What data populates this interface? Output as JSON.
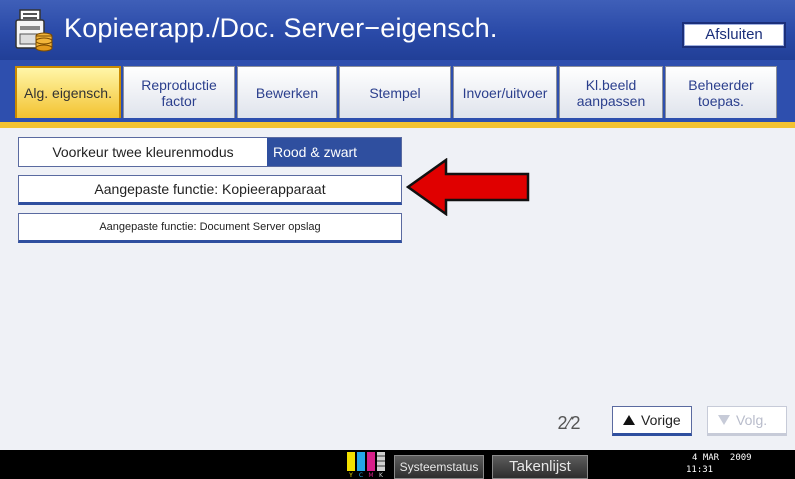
{
  "window": {
    "title": "Kopieerapp./Doc. Server−eigensch.",
    "exit_label": "Afsluiten",
    "icon": "copier-settings-icon"
  },
  "tabs": [
    {
      "label": "Alg. eigensch.",
      "active": true
    },
    {
      "label": "Reproductie\nfactor",
      "active": false
    },
    {
      "label": "Bewerken",
      "active": false
    },
    {
      "label": "Stempel",
      "active": false
    },
    {
      "label": "Invoer/uitvoer",
      "active": false
    },
    {
      "label": "Kl.beeld\naanpassen",
      "active": false
    },
    {
      "label": "Beheerder\ntoepas.",
      "active": false
    }
  ],
  "settings": {
    "two_color_label": "Voorkeur twee kleurenmodus",
    "two_color_value": "Rood & zwart",
    "custom_copier": "Aangepaste functie: Kopieerapparaat",
    "custom_docserver": "Aangepaste functie: Document Server opslag"
  },
  "pagination": {
    "current": 2,
    "total": 2,
    "indicator": "2∕2",
    "prev_label": "Vorige",
    "next_label": "Volg."
  },
  "statusbar": {
    "toner_letters": "YCMK",
    "system_status": "Systeemstatus",
    "jobs": "Takenlijst",
    "date": "4 MAR  2009",
    "time": "11:31"
  },
  "colors": {
    "accent_blue": "#2e4fae",
    "active_tab": "#f3c230",
    "arrow_red": "#e00000"
  }
}
